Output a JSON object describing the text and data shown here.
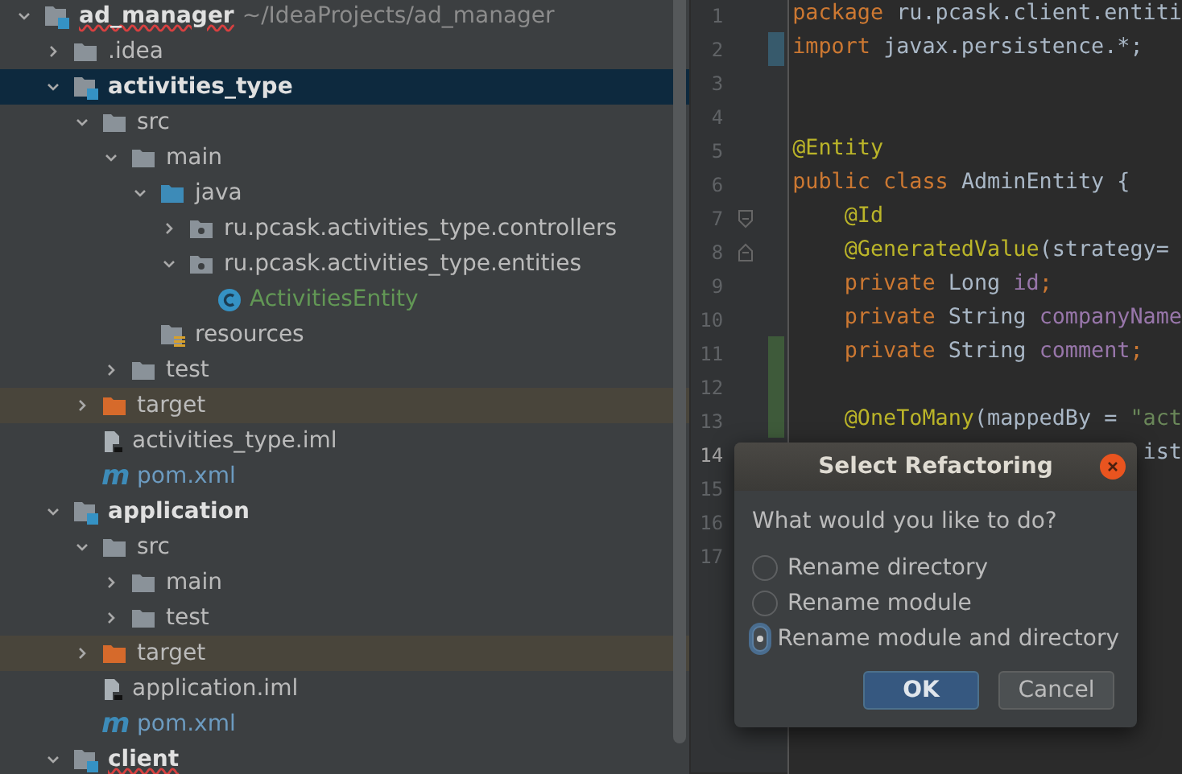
{
  "project_tree": {
    "items": [
      {
        "name": "ad_manager",
        "kind": "module",
        "path": "~/IdeaProjects/ad_manager",
        "expanded": true,
        "selected": false,
        "misspelled": true,
        "children": [
          {
            "name": ".idea",
            "kind": "folder",
            "expanded": false,
            "selected": false
          },
          {
            "name": "activities_type",
            "kind": "module",
            "expanded": true,
            "selected": true,
            "children": [
              {
                "name": "src",
                "kind": "folder",
                "expanded": true,
                "selected": false,
                "children": [
                  {
                    "name": "main",
                    "kind": "folder",
                    "expanded": true,
                    "selected": false,
                    "children": [
                      {
                        "name": "java",
                        "kind": "source_folder",
                        "expanded": true,
                        "selected": false,
                        "children": [
                          {
                            "name": "ru.pcask.activities_type.controllers",
                            "kind": "package",
                            "expanded": false,
                            "selected": false
                          },
                          {
                            "name": "ru.pcask.activities_type.entities",
                            "kind": "package",
                            "expanded": true,
                            "selected": false,
                            "children": [
                              {
                                "name": "ActivitiesEntity",
                                "kind": "class",
                                "selected": false
                              }
                            ]
                          }
                        ]
                      },
                      {
                        "name": "resources",
                        "kind": "resources",
                        "selected": false
                      }
                    ]
                  },
                  {
                    "name": "test",
                    "kind": "folder",
                    "expanded": false,
                    "selected": false
                  }
                ]
              },
              {
                "name": "target",
                "kind": "excluded_folder",
                "expanded": false,
                "selected": false
              },
              {
                "name": "activities_type.iml",
                "kind": "iml",
                "selected": false
              },
              {
                "name": "pom.xml",
                "kind": "maven",
                "badge": "m",
                "selected": false
              }
            ]
          },
          {
            "name": "application",
            "kind": "module",
            "expanded": true,
            "selected": false,
            "children": [
              {
                "name": "src",
                "kind": "folder",
                "expanded": true,
                "selected": false,
                "children": [
                  {
                    "name": "main",
                    "kind": "folder",
                    "expanded": false,
                    "selected": false
                  },
                  {
                    "name": "test",
                    "kind": "folder",
                    "expanded": false,
                    "selected": false
                  }
                ]
              },
              {
                "name": "target",
                "kind": "excluded_folder",
                "expanded": false,
                "selected": false
              },
              {
                "name": "application.iml",
                "kind": "iml",
                "selected": false
              },
              {
                "name": "pom.xml",
                "kind": "maven",
                "badge": "m",
                "selected": false
              }
            ]
          },
          {
            "name": "client",
            "kind": "module",
            "expanded": true,
            "selected": false,
            "misspelled": true
          }
        ]
      }
    ]
  },
  "editor": {
    "lines": [
      {
        "number": "1",
        "tokens": [
          {
            "text": "package ",
            "kind": "keyword"
          },
          {
            "text": "ru.pcask.client.entiti",
            "kind": "plain"
          }
        ]
      },
      {
        "number": "2",
        "modified": true,
        "tokens": [
          {
            "text": "import ",
            "kind": "keyword"
          },
          {
            "text": "javax.persistence.*;",
            "kind": "plain"
          }
        ]
      },
      {
        "number": "3"
      },
      {
        "number": "4"
      },
      {
        "number": "5",
        "tokens": [
          {
            "text": "@Entity",
            "kind": "annotation"
          }
        ]
      },
      {
        "number": "6",
        "tokens": [
          {
            "text": "public class ",
            "kind": "keyword"
          },
          {
            "text": "AdminEntity {",
            "kind": "plain"
          }
        ]
      },
      {
        "number": "7",
        "fold_start": true,
        "tokens": [
          {
            "text": "    @Id",
            "kind": "annotation"
          }
        ]
      },
      {
        "number": "8",
        "fold_end": true,
        "tokens": [
          {
            "text": "    @GeneratedValue",
            "kind": "annotation"
          },
          {
            "text": "(strategy= ",
            "kind": "plain"
          }
        ]
      },
      {
        "number": "9",
        "tokens": [
          {
            "text": "    private ",
            "kind": "keyword"
          },
          {
            "text": "Long ",
            "kind": "plain"
          },
          {
            "text": "id",
            "kind": "field"
          },
          {
            "text": ";",
            "kind": "keyword"
          }
        ]
      },
      {
        "number": "10",
        "tokens": [
          {
            "text": "    private ",
            "kind": "keyword"
          },
          {
            "text": "String ",
            "kind": "plain"
          },
          {
            "text": "companyName",
            "kind": "field"
          }
        ]
      },
      {
        "number": "11",
        "added": true,
        "tokens": [
          {
            "text": "    private ",
            "kind": "keyword"
          },
          {
            "text": "String ",
            "kind": "plain"
          },
          {
            "text": "comment",
            "kind": "field"
          },
          {
            "text": ";",
            "kind": "keyword"
          }
        ]
      },
      {
        "number": "12",
        "added": true
      },
      {
        "number": "13",
        "added": true,
        "tokens": [
          {
            "text": "    @OneToMany",
            "kind": "annotation"
          },
          {
            "text": "(mappedBy = ",
            "kind": "plain"
          },
          {
            "text": "\"act",
            "kind": "string"
          }
        ]
      },
      {
        "number": "14",
        "current": true,
        "tokens": [
          {
            "text": "                           ist",
            "kind": "plain"
          }
        ]
      },
      {
        "number": "15"
      },
      {
        "number": "16"
      },
      {
        "number": "17"
      }
    ]
  },
  "dialog": {
    "title": "Select Refactoring",
    "question": "What would you like to do?",
    "options": [
      {
        "label": "Rename directory",
        "selected": false
      },
      {
        "label": "Rename module",
        "selected": false
      },
      {
        "label": "Rename module and directory",
        "selected": true
      }
    ],
    "buttons": [
      {
        "label": "OK",
        "kind": "primary"
      },
      {
        "label": "Cancel",
        "kind": "secondary"
      }
    ]
  }
}
